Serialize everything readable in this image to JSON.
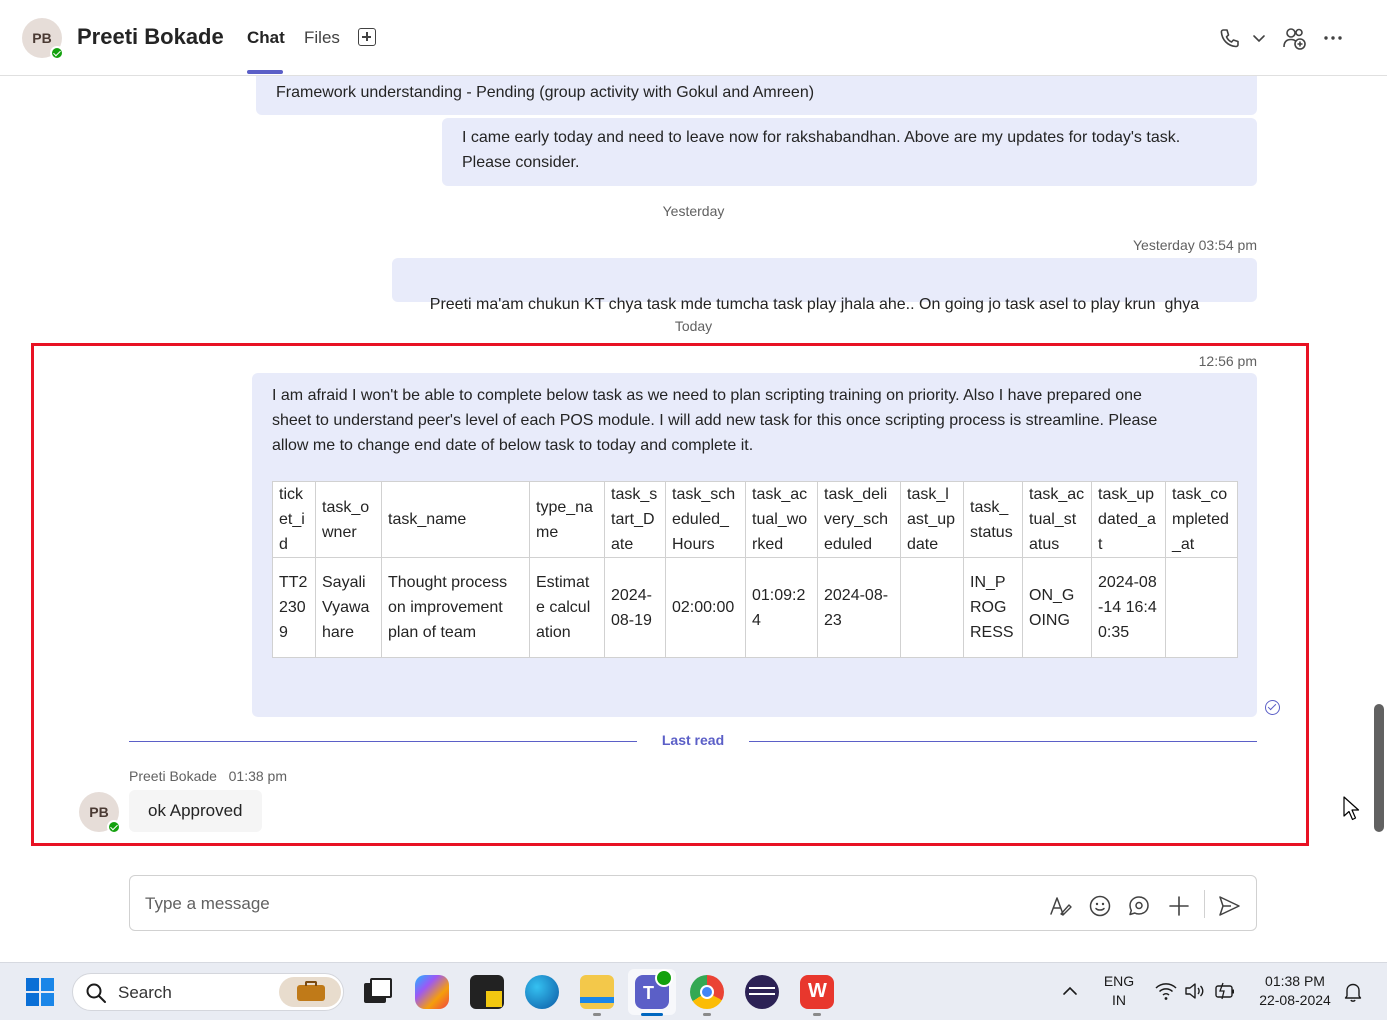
{
  "header": {
    "avatar_initials": "PB",
    "contact_name": "Preeti Bokade",
    "tabs": [
      {
        "label": "Chat",
        "active": true
      },
      {
        "label": "Files",
        "active": false
      }
    ]
  },
  "messages": {
    "msg1_text": "Framework understanding - Pending (group activity with Gokul and Amreen)",
    "msg2_line1": "I came early today and need to leave now for rakshabandhan. Above are my updates for today's task.",
    "msg2_line2": "Please consider.",
    "day_yesterday": "Yesterday",
    "msg3_timestamp": "Yesterday 03:54 pm",
    "msg3_text": "Preeti ma'am chukun KT chya task mde tumcha task play jhala ahe.. On going jo task asel to play krun  ghya",
    "day_today": "Today",
    "msg4_timestamp": "12:56 pm",
    "msg4_line1": "I am afraid I won't be able to complete below task as we need to plan scripting training on priority. Also I have prepared one",
    "msg4_line2": "sheet to understand peer's level of each POS module. I will add new task for this once scripting process is streamline. Please",
    "msg4_line3": "allow me to change end date of below task to today and complete it.",
    "last_read_label": "Last read",
    "reply_sender": "Preeti Bokade",
    "reply_time": "01:38 pm",
    "reply_avatar_initials": "PB",
    "reply_text": "ok Approved"
  },
  "task_table": {
    "headers": [
      "ticket_id",
      "task_owner",
      "task_name",
      "type_name",
      "task_start_Date",
      "task_scheduled_Hours",
      "task_actual_worked",
      "task_delivery_scheduled",
      "task_last_update",
      "task_status",
      "task_actual_status",
      "task_updated_at",
      "task_completed_at"
    ],
    "row": [
      "TT22309",
      "Sayali Vyawahare",
      "Thought process on improvement plan of team",
      "Estimate calculation",
      "2024-08-19",
      "02:00:00",
      "01:09:24",
      "2024-08-23",
      "",
      "IN_PROGRESS",
      "ON_GOING",
      "2024-08-14 16:40:35",
      ""
    ]
  },
  "composer": {
    "placeholder": "Type a message"
  },
  "taskbar": {
    "search_label": "Search",
    "lang_line1": "ENG",
    "lang_line2": "IN",
    "time": "01:38 PM",
    "date": "22-08-2024"
  },
  "colors": {
    "accent": "#5b5fc7",
    "bubble_self": "#e8ebfa",
    "highlight": "#e81123",
    "presence": "#13a10e"
  },
  "icons": [
    "call-icon",
    "chevron-down-icon",
    "add-people-icon",
    "more-options-icon",
    "format-icon",
    "emoji-icon",
    "loop-icon",
    "attach-plus-icon",
    "send-icon",
    "windows-start-icon",
    "search-icon",
    "seen-check-icon"
  ]
}
